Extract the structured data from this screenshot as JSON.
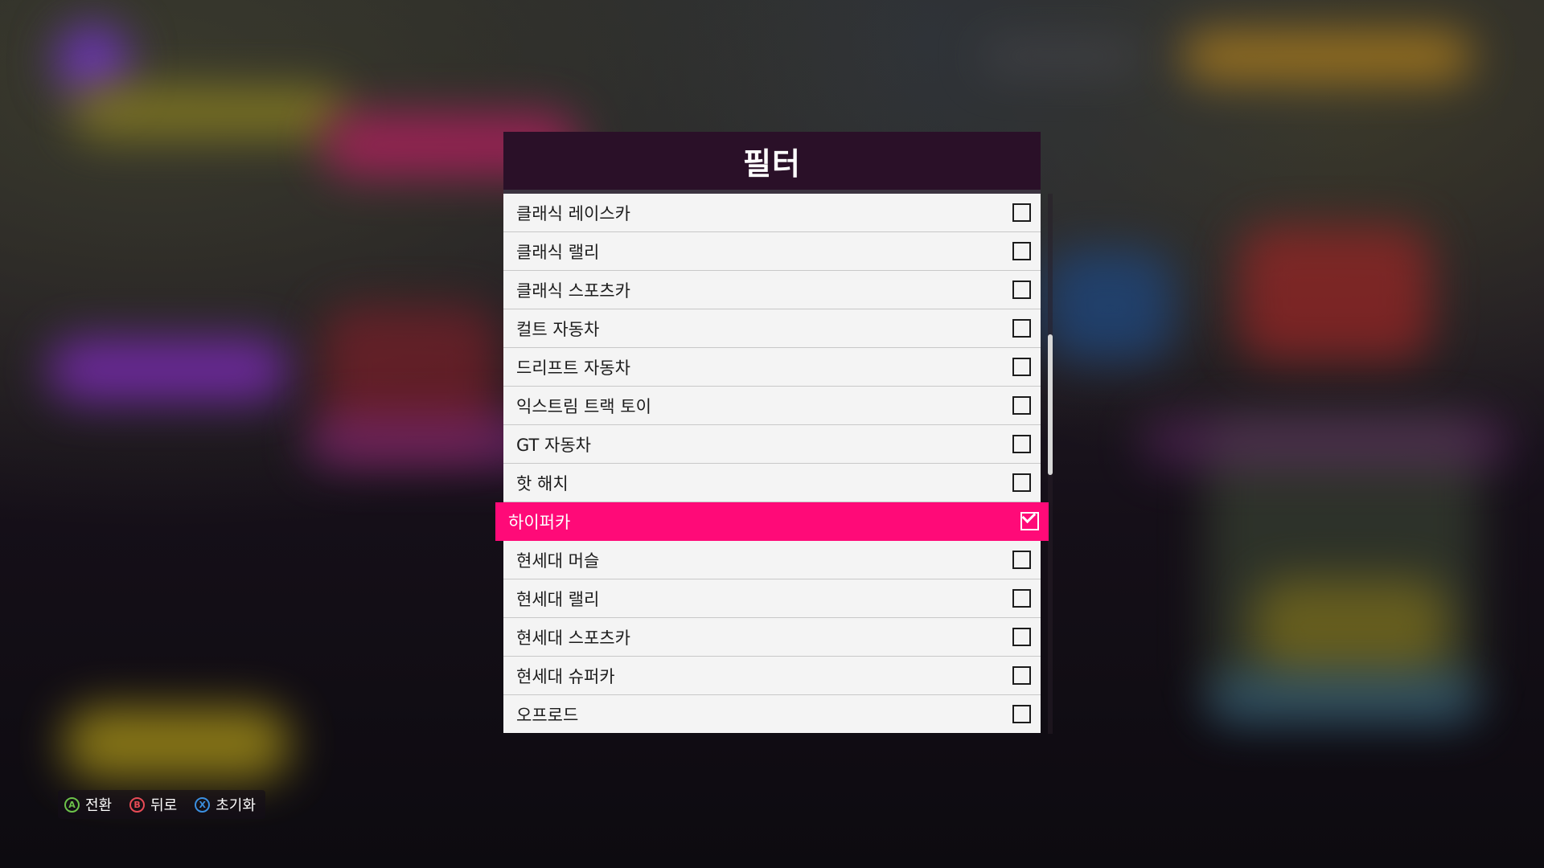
{
  "dialog": {
    "title": "필터",
    "items": [
      {
        "label": "클래식 레이스카",
        "checked": false
      },
      {
        "label": "클래식 랠리",
        "checked": false
      },
      {
        "label": "클래식 스포츠카",
        "checked": false
      },
      {
        "label": "컬트 자동차",
        "checked": false
      },
      {
        "label": "드리프트 자동차",
        "checked": false
      },
      {
        "label": "익스트림 트랙 토이",
        "checked": false
      },
      {
        "label": "GT 자동차",
        "checked": false
      },
      {
        "label": "핫 해치",
        "checked": false
      },
      {
        "label": "하이퍼카",
        "checked": true,
        "selected": true
      },
      {
        "label": "현세대 머슬",
        "checked": false
      },
      {
        "label": "현세대 랠리",
        "checked": false
      },
      {
        "label": "현세대 스포츠카",
        "checked": false
      },
      {
        "label": "현세대 슈퍼카",
        "checked": false
      },
      {
        "label": "오프로드",
        "checked": false
      }
    ]
  },
  "scrollbar": {
    "position_fraction": 0.26,
    "visible_fraction": 0.26
  },
  "hints": [
    {
      "glyph": "A",
      "label": "전환",
      "icon": "a-button-icon"
    },
    {
      "glyph": "B",
      "label": "뒤로",
      "icon": "b-button-icon"
    },
    {
      "glyph": "X",
      "label": "초기화",
      "icon": "x-button-icon"
    }
  ],
  "colors": {
    "accent": "#ff0a78",
    "header_bg": "#2a1028",
    "list_bg": "#f4f4f4",
    "button_a": "#6cc24a",
    "button_b": "#e84b56",
    "button_x": "#3b8fe0"
  }
}
